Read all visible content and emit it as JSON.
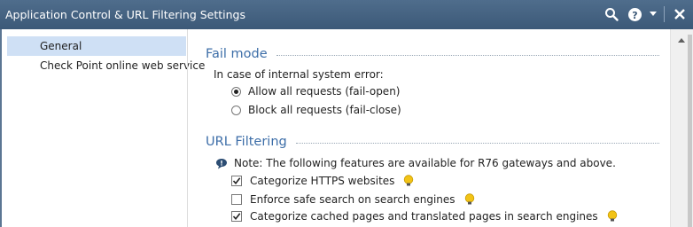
{
  "window": {
    "title": "Application Control & URL Filtering Settings"
  },
  "sidebar": {
    "items": [
      {
        "label": "General",
        "selected": true
      },
      {
        "label": "Check Point online web service",
        "selected": false
      }
    ]
  },
  "fail_mode": {
    "heading": "Fail mode",
    "prompt": "In case of internal system error:",
    "options": [
      {
        "label": "Allow all requests (fail-open)",
        "selected": true
      },
      {
        "label": "Block all requests (fail-close)",
        "selected": false
      }
    ]
  },
  "url_filtering": {
    "heading": "URL Filtering",
    "note": "Note: The following features are available for R76 gateways and above.",
    "checkboxes": [
      {
        "label": "Categorize HTTPS websites",
        "checked": true,
        "icon": "lightbulb-icon"
      },
      {
        "label": "Enforce safe search on search engines",
        "checked": false,
        "icon": "lightbulb-icon"
      },
      {
        "label": "Categorize cached pages and translated pages in search engines",
        "checked": true,
        "icon": "lightbulb-icon"
      }
    ]
  },
  "colors": {
    "titlebar": "#3c5978",
    "heading": "#3d6ea8",
    "selection": "#cfe0f5",
    "bulb": "#f2c316"
  }
}
